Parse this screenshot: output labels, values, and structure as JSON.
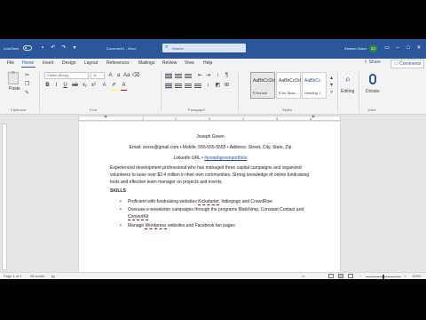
{
  "titlebar": {
    "autosave_label": "AutoSave",
    "doc_title": "Document1 - Word",
    "search_placeholder": "Search",
    "user_name": "Zeneco Gucci",
    "avatar_initials": "ZG"
  },
  "tabs": [
    "File",
    "Home",
    "Insert",
    "Design",
    "Layout",
    "References",
    "Mailings",
    "Review",
    "View",
    "Help"
  ],
  "actions": {
    "share": "Share",
    "comments": "Comments"
  },
  "ribbon": {
    "paste_label": "Paste",
    "font_name": "Calibri (Body)",
    "font_size": "11",
    "groups": [
      "Clipboard",
      "Font",
      "Paragraph",
      "Styles",
      "Voice"
    ],
    "styles": [
      {
        "sample": "AaBbCcDd",
        "name": "¶ Normal"
      },
      {
        "sample": "AaBbCcDd",
        "name": "¶ No Spac..."
      },
      {
        "sample": "AaBbCc",
        "name": "Heading 1"
      }
    ],
    "editing_label": "Editing",
    "dictate_label": "Dictate"
  },
  "ruler": {
    "numbers": [
      "1",
      "2",
      "3",
      "4",
      "5",
      "6"
    ]
  },
  "document": {
    "name": "Joseph Green",
    "contact": "Email: xxxxx@gmail.com • Mobile: 555-555-5555 • Address: Street, City, State, Zip",
    "linkedin_prefix": "LinkedIn URL • ",
    "linkedin_link": "#josephgreenportfolio",
    "summary": "Experienced development professional who has managed three capital campaigns and organized volunteers to raise over $2.4 million in their own communities. Strong knowledge of online fundraising tools and effective team manager on projects and events.",
    "skills_heading": "SKILLS",
    "bullets": [
      {
        "pre": "Proficient with fundraising websites ",
        "flag": "Kickstarter",
        "post": ", Indiegogo and CrowdRise"
      },
      {
        "pre": "Oversaw e-newsletter campaigns through the programs Mailchimp, Constant Contact and ",
        "flag": "ConvertKit",
        "post": ""
      },
      {
        "pre": "Manage ",
        "flag": "Wordpress",
        "post": " websites and Facebook fan pages"
      }
    ]
  },
  "statusbar": {
    "page_info": "Page 1 of 1",
    "word_count": "98 words",
    "zoom": "100%"
  },
  "colors": {
    "word_blue": "#2b579a",
    "link_blue": "#1f4fb4",
    "avatar_green": "#2e8b3e"
  }
}
